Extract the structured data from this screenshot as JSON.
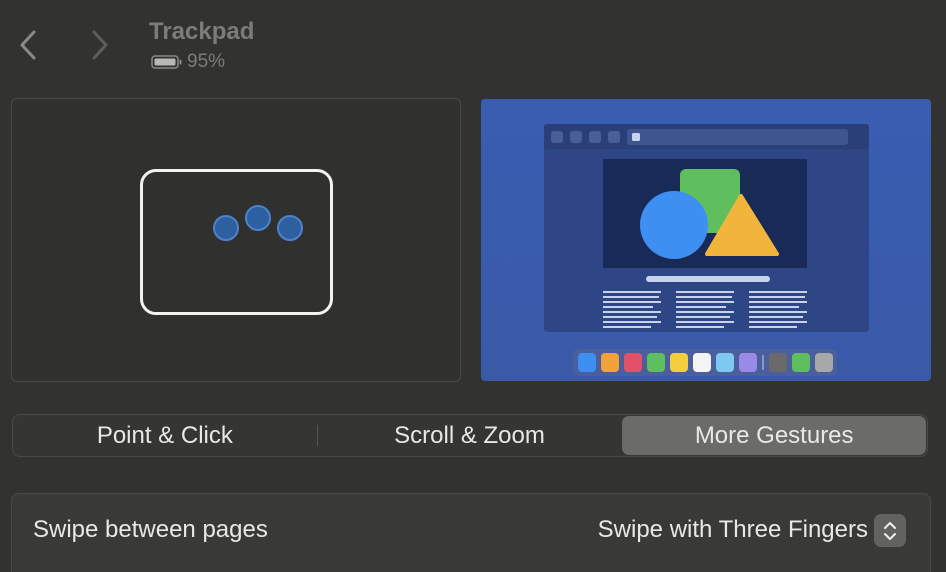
{
  "header": {
    "title": "Trackpad",
    "battery_percent": "95%",
    "back_icon": "chevron-left-icon",
    "forward_icon": "chevron-right-icon",
    "battery_icon": "battery-icon"
  },
  "tabs": [
    {
      "label": "Point & Click",
      "selected": false
    },
    {
      "label": "Scroll & Zoom",
      "selected": false
    },
    {
      "label": "More Gestures",
      "selected": true
    }
  ],
  "settings": [
    {
      "label": "Swipe between pages",
      "value": "Swipe with Three Fingers",
      "control_icon": "updown-chevron-icon"
    }
  ],
  "colors": {
    "background": "#323230",
    "selected_tab": "#6b6b69",
    "finger": "#2e5f9e",
    "preview_bg": "#3a5db2"
  }
}
